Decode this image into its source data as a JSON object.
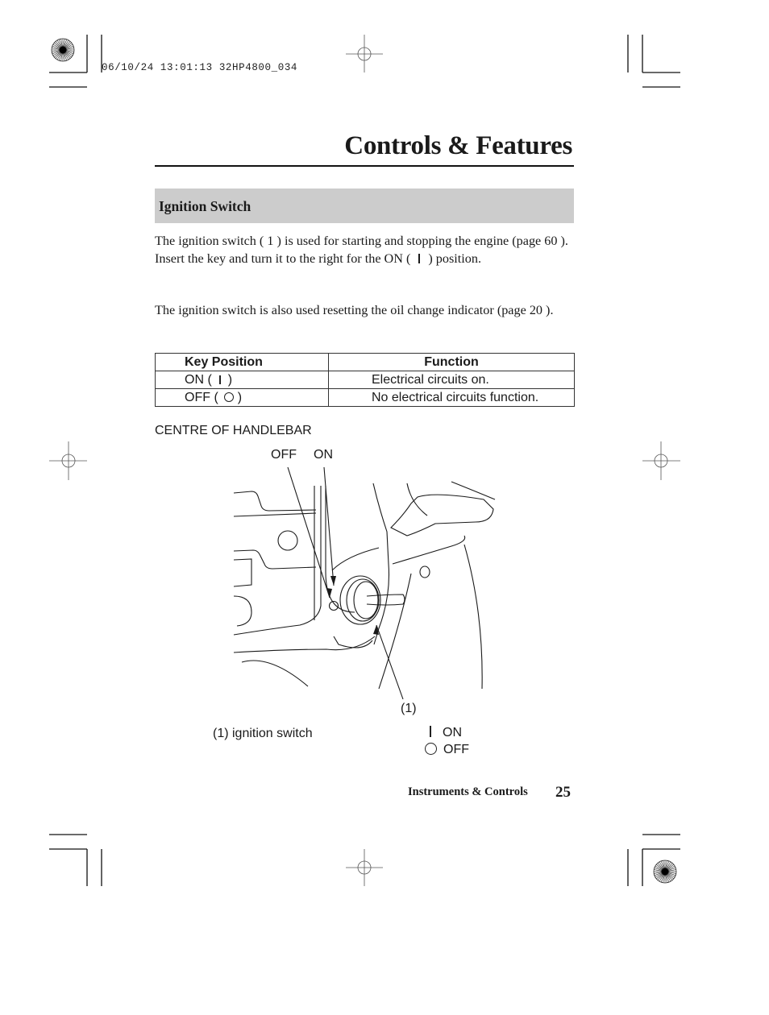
{
  "print_slug": "06/10/24 13:01:13 32HP4800_034",
  "page_title": "Controls & Features",
  "section": {
    "heading": "Ignition Switch",
    "paragraph_1": {
      "text_a": "The ignition switch ( 1 ) is used for starting and stopping the engine (page  60 ). Insert the key and turn it to the right for the ON (",
      "text_b": ") position."
    },
    "paragraph_2": "The ignition switch is also used resetting the oil change indicator (page  20 )."
  },
  "key_table": {
    "headers": [
      "Key Position",
      "Function"
    ],
    "rows": [
      {
        "position_label": "ON (",
        "position_symbol": "bar-icon",
        "position_close": ")",
        "function": "Electrical circuits on."
      },
      {
        "position_label": "OFF (",
        "position_symbol": "circle-icon",
        "position_close": ")",
        "function": "No electrical circuits function."
      }
    ]
  },
  "figure": {
    "caption": "CENTRE OF HANDLEBAR",
    "callout_off": "OFF",
    "callout_on": "ON",
    "callout_number": "(1)",
    "legend_item": "(1) ignition switch",
    "symbol_legend": [
      {
        "symbol": "bar-icon",
        "label": "ON"
      },
      {
        "symbol": "circle-icon",
        "label": "OFF"
      }
    ]
  },
  "footer": {
    "section_name": "Instruments & Controls",
    "page_number": "25"
  }
}
